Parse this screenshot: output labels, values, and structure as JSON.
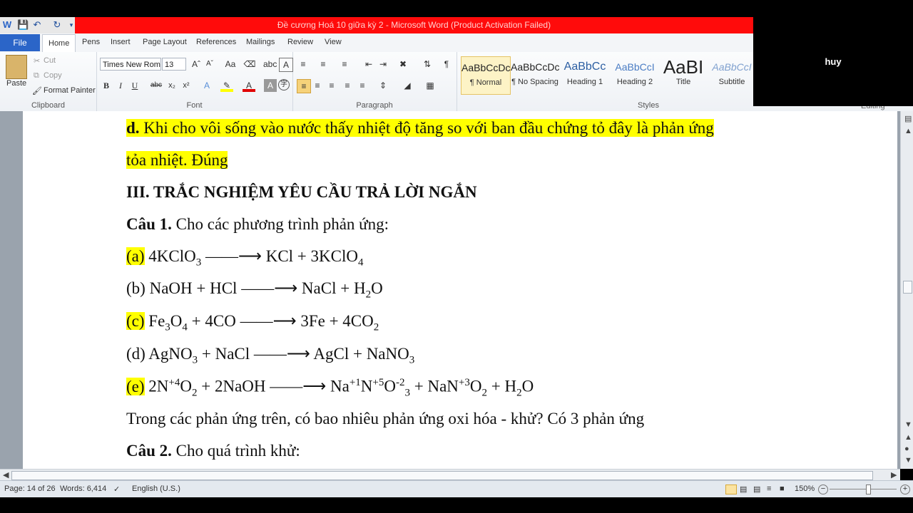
{
  "window": {
    "title": "Đề cương Hoá 10 giữa kỳ 2  -  Microsoft Word (Product Activation Failed)",
    "participant_name": "huy"
  },
  "tabs": [
    "File",
    "Home",
    "Pens",
    "Insert",
    "Page Layout",
    "References",
    "Mailings",
    "Review",
    "View"
  ],
  "ribbon": {
    "clipboard": {
      "paste": "Paste",
      "cut": "Cut",
      "copy": "Copy",
      "format_painter": "Format Painter",
      "label": "Clipboard"
    },
    "font": {
      "name": "Times New Rom",
      "size": "13",
      "label": "Font"
    },
    "paragraph": {
      "label": "Paragraph"
    },
    "styles": {
      "label": "Styles",
      "items": [
        {
          "preview": "AaBbCcDc",
          "name": "¶ Normal"
        },
        {
          "preview": "AaBbCcDc",
          "name": "¶ No Spacing"
        },
        {
          "preview": "AaBbCc",
          "name": "Heading 1"
        },
        {
          "preview": "AaBbCcI",
          "name": "Heading 2"
        },
        {
          "preview": "AaBI",
          "name": "Title"
        },
        {
          "preview": "AaBbCcI",
          "name": "Subtitle"
        }
      ]
    },
    "editing": {
      "label": "Editing"
    }
  },
  "document": {
    "d_label": "d.",
    "d_text": " Khi cho vôi sống vào nước thấy nhiệt độ tăng so với ban đầu chứng tỏ đây là phản ứng",
    "d_text2": "tỏa nhiệt. Đúng",
    "section_heading": "III. TRẮC NGHIỆM YÊU CẦU TRẢ LỜI NGẮN",
    "q1_label": "Câu 1.",
    "q1_text": " Cho các phương trình phản ứng:",
    "reactions": {
      "a_label": "(a)",
      "b_label": "(b)",
      "c_label": "(c)",
      "d_label": "(d)",
      "e_label": "(e)",
      "arrow": "——⟶"
    },
    "question_line": "Trong các phản ứng trên, có bao nhiêu phản ứng oxi hóa - khử? Có 3 phản ứng",
    "q2_label": "Câu 2.",
    "q2_text": " Cho quá trình khử:"
  },
  "status": {
    "page": "Page: 14 of 26",
    "words": "Words: 6,414",
    "language": "English (U.S.)",
    "zoom": "150%"
  }
}
